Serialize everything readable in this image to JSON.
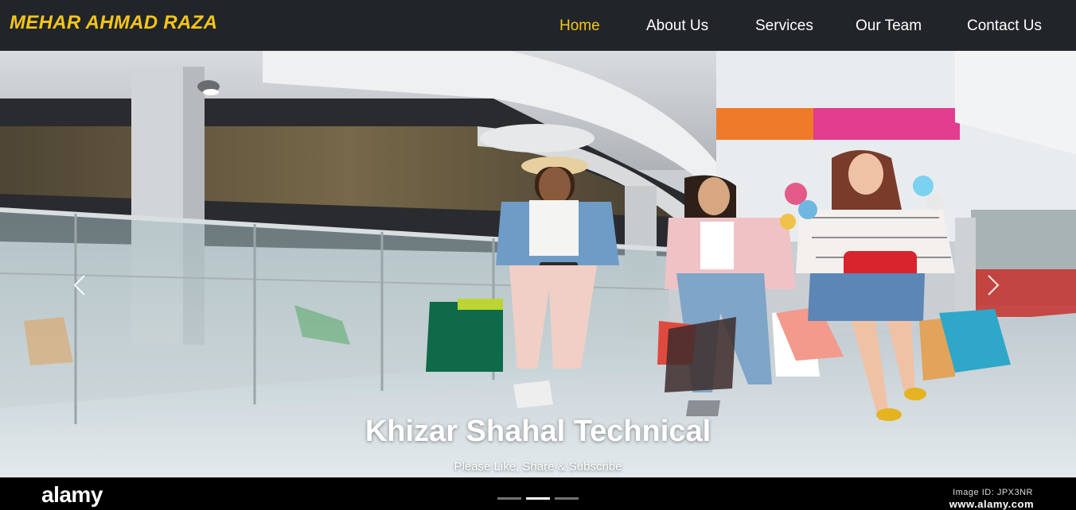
{
  "navbar": {
    "brand": "MEHAR AHMAD RAZA",
    "links": [
      {
        "label": "Home",
        "active": true
      },
      {
        "label": "About Us",
        "active": false
      },
      {
        "label": "Services",
        "active": false
      },
      {
        "label": "Our Team",
        "active": false
      },
      {
        "label": "Contact Us",
        "active": false
      }
    ]
  },
  "carousel": {
    "caption_title": "Khizar Shahal Technical",
    "caption_subtitle": "Please Like, Share & Subscribe",
    "slide_count": 3,
    "active_slide": 2,
    "prev_icon": "chevron-left-icon",
    "next_icon": "chevron-right-icon"
  },
  "watermark": {
    "logo": "alamy",
    "image_id": "Image ID: JPX3NR",
    "site": "www.alamy.com"
  },
  "colors": {
    "navbar_bg": "#212529",
    "brand": "#f5c518",
    "active_link": "#f5c518",
    "link": "#ffffff"
  }
}
